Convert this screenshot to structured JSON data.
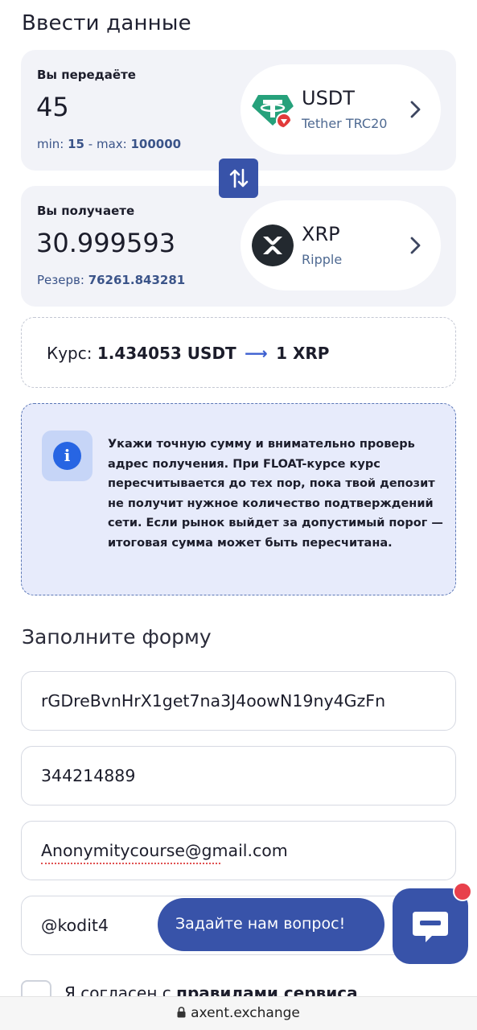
{
  "page": {
    "title": "Ввести данные"
  },
  "send": {
    "label": "Вы передаёте",
    "amount": "45",
    "min_label": "min:",
    "min_value": "15",
    "max_label": "- max:",
    "max_value": "100000",
    "currency_code": "USDT",
    "currency_name": "Tether TRC20",
    "icon": "tether-icon"
  },
  "receive": {
    "label": "Вы получаете",
    "amount": "30.999593",
    "reserve_label": "Резерв:",
    "reserve_value": "76261.843281",
    "currency_code": "XRP",
    "currency_name": "Ripple",
    "icon": "xrp-icon"
  },
  "rate": {
    "label": "Курс:",
    "from": "1.434053 USDT",
    "arrow": "⟶",
    "to": "1 XRP"
  },
  "notice": {
    "icon": "info-icon",
    "text": "Укажи точную сумму и внимательно проверь адрес получения. При FLOAT-курсе курс пересчитывается до тех пор, пока твой депозит не получит нужное количество подтверждений сети. Если рынок выйдет за допустимый порог — итоговая сумма может быть пересчитана."
  },
  "form": {
    "title": "Заполните форму",
    "wallet_value": "rGDreBvnHrX1get7na3J4oowN19ny4GzFn",
    "tag_value": "344214889",
    "email_value": "Anonymitycourse@gmail.com",
    "telegram_value": "@kodit4"
  },
  "consent": {
    "prefix": "Я согласен с",
    "link": "правилами сервиса"
  },
  "chat": {
    "label": "Задайте нам вопрос!",
    "icon": "chat-icon"
  },
  "browser": {
    "url": "axent.exchange"
  },
  "colors": {
    "accent": "#3853a9",
    "card_bg": "#f2f3f8",
    "notice_bg": "#e7ebfb",
    "badge": "#e8404b",
    "tether": "#26a17b"
  }
}
